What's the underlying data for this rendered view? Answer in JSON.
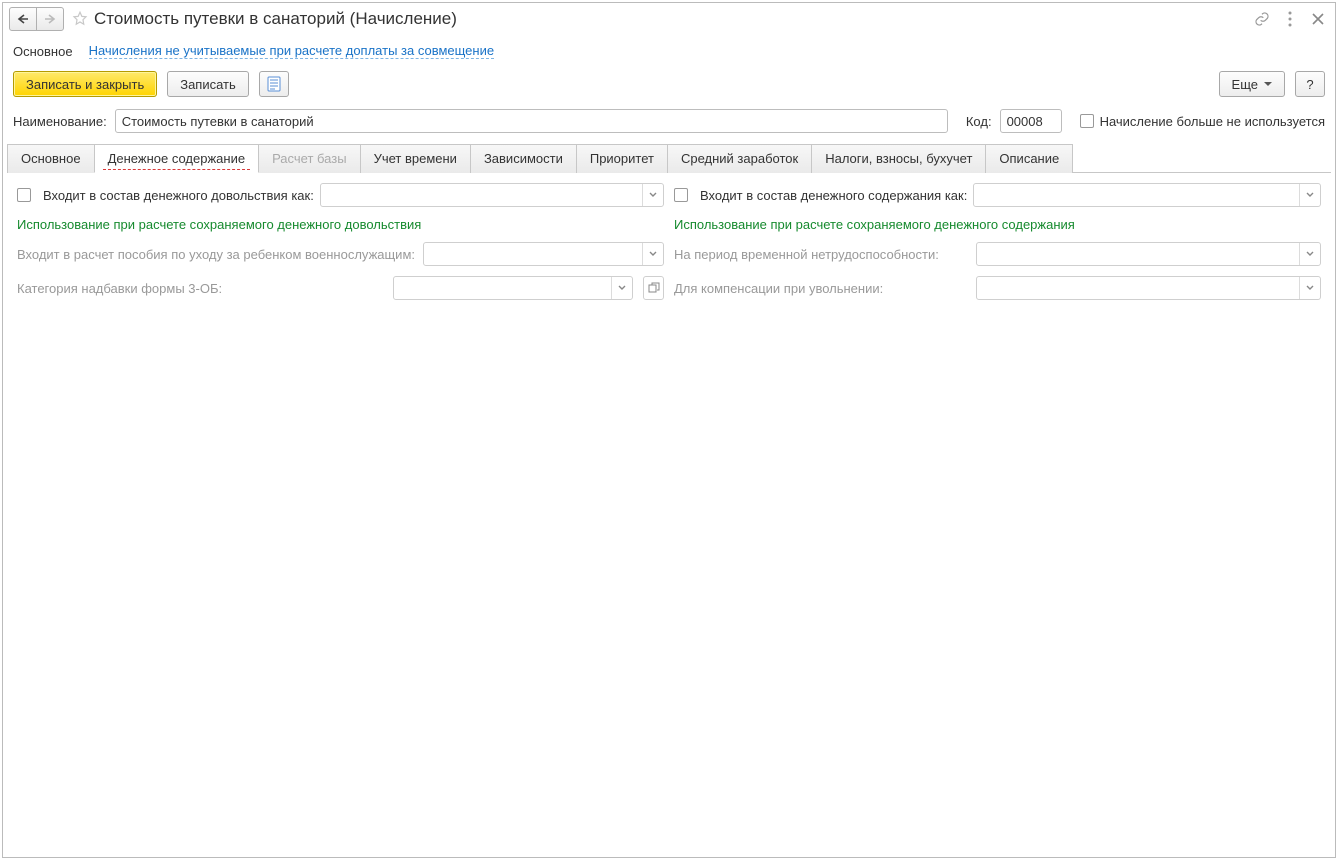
{
  "title": "Стоимость путевки в санаторий (Начисление)",
  "secnav": {
    "main": "Основное",
    "link": "Начисления не учитываемые при расчете доплаты за совмещение"
  },
  "toolbar": {
    "save_close": "Записать и закрыть",
    "save": "Записать",
    "more": "Еще",
    "help": "?"
  },
  "fields": {
    "name_label": "Наименование:",
    "name_value": "Стоимость путевки в санаторий",
    "code_label": "Код:",
    "code_value": "00008",
    "not_used_label": "Начисление больше не используется"
  },
  "tabs": [
    "Основное",
    "Денежное содержание",
    "Расчет базы",
    "Учет времени",
    "Зависимости",
    "Приоритет",
    "Средний заработок",
    "Налоги, взносы, бухучет",
    "Описание"
  ],
  "left": {
    "check_label": "Входит в состав денежного довольствия как:",
    "heading": "Использование при расчете сохраняемого денежного довольствия",
    "row1": "Входит в расчет пособия по уходу за ребенком военнослужащим:",
    "row2": "Категория надбавки формы 3-ОБ:"
  },
  "right": {
    "check_label": "Входит в состав денежного содержания как:",
    "heading": "Использование при расчете сохраняемого денежного содержания",
    "row1": "На период временной нетрудоспособности:",
    "row2": "Для компенсации при увольнении:"
  }
}
